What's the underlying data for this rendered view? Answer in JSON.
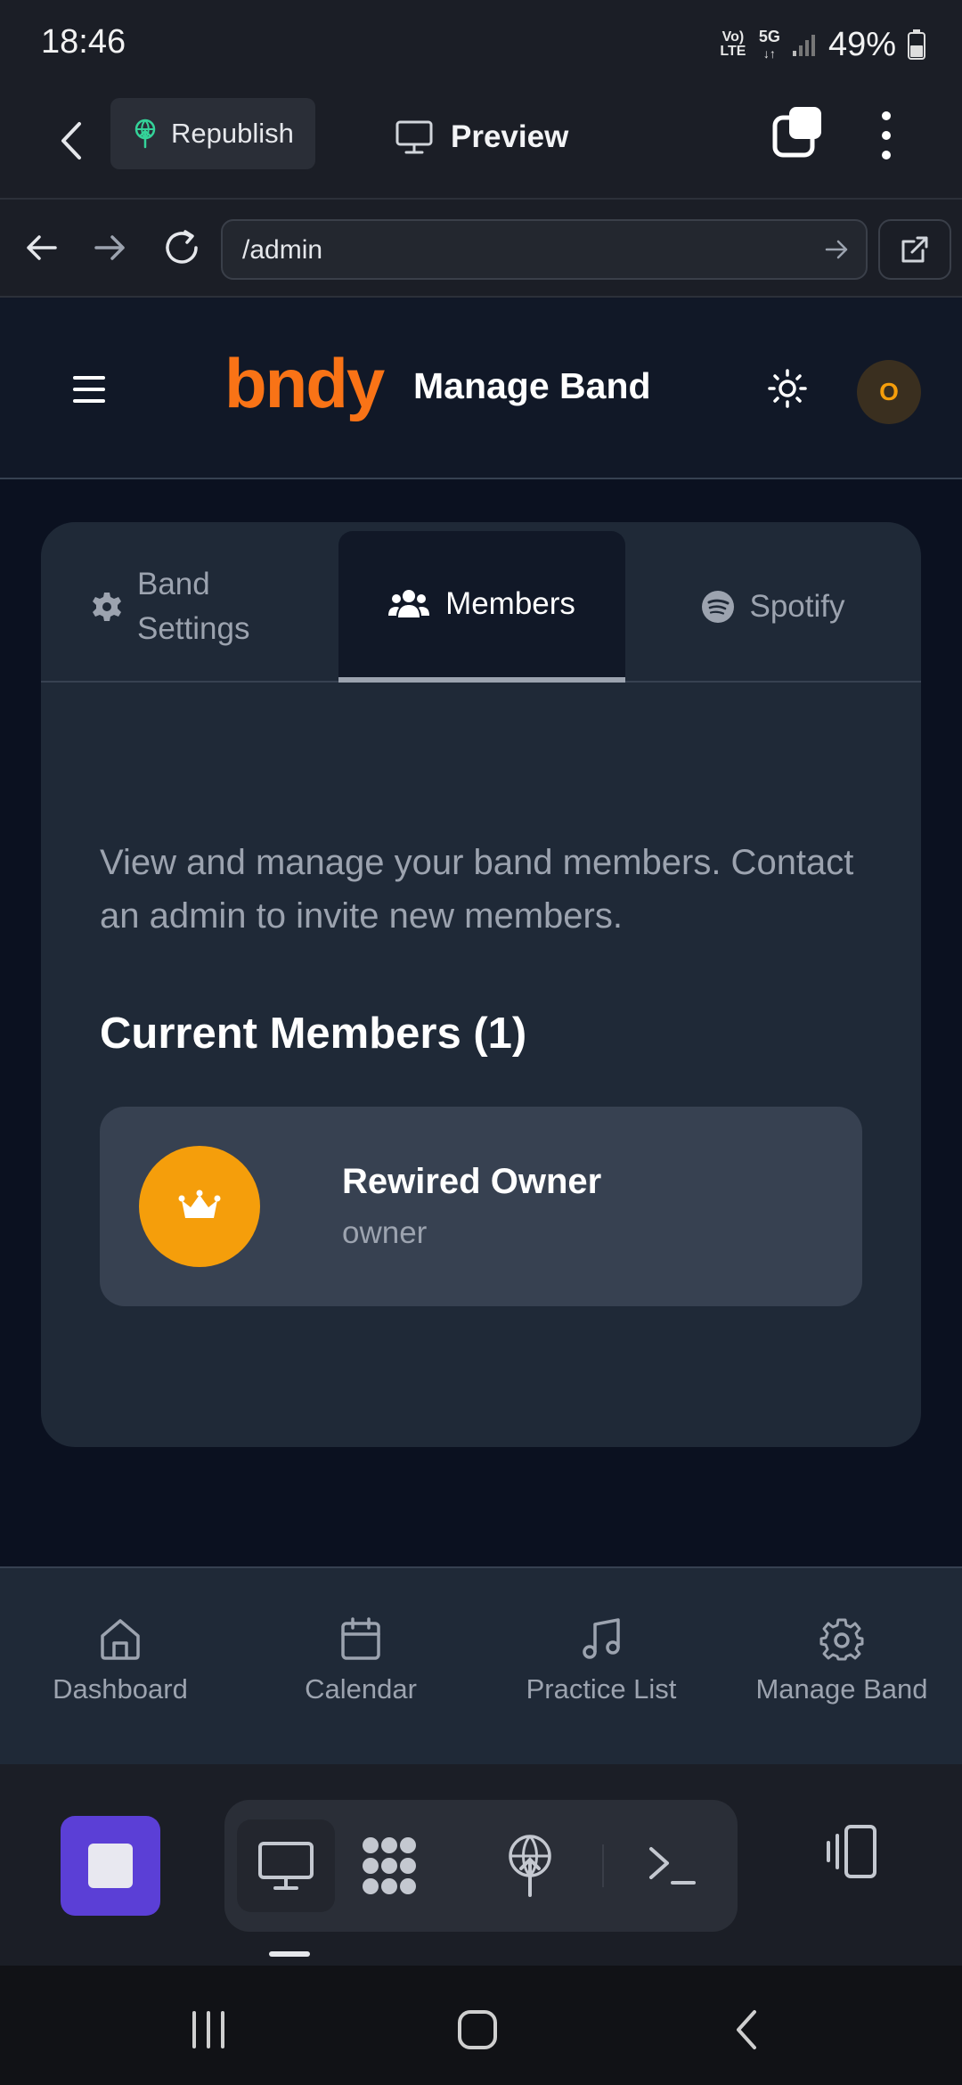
{
  "status_bar": {
    "time": "18:46",
    "volte": "Vo) LTE",
    "network": "5G",
    "battery": "49%"
  },
  "app_toolbar": {
    "republish_label": "Republish",
    "preview_label": "Preview"
  },
  "browser": {
    "url": "/admin"
  },
  "site": {
    "logo": "bndy",
    "title": "Manage Band",
    "avatar_initial": "O",
    "accent_color": "#f97316"
  },
  "tabs": [
    {
      "label": "Band Settings",
      "icon": "gear-icon",
      "active": false
    },
    {
      "label": "Members",
      "icon": "users-icon",
      "active": true
    },
    {
      "label": "Spotify",
      "icon": "spotify-icon",
      "active": false
    }
  ],
  "members_panel": {
    "description": "View and manage your band members. Contact an admin to invite new members.",
    "section_title": "Current Members (1)",
    "members": [
      {
        "name": "Rewired Owner",
        "role": "owner",
        "icon": "crown-icon",
        "avatar_color": "#f59e0b"
      }
    ]
  },
  "bottom_nav": [
    {
      "label": "Dashboard",
      "icon": "home-icon"
    },
    {
      "label": "Calendar",
      "icon": "calendar-icon"
    },
    {
      "label": "Practice List",
      "icon": "music-note-icon"
    },
    {
      "label": "Manage Band",
      "icon": "gear-icon"
    }
  ],
  "dock": {
    "items": [
      "monitor-icon",
      "extensions-icon",
      "deploy-icon",
      "terminal-icon"
    ],
    "stop_color": "#5b3fd6"
  }
}
